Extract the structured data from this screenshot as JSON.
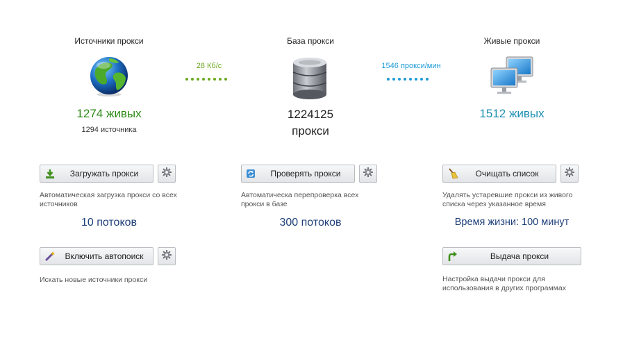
{
  "sources": {
    "title": "Источники прокси",
    "live_count": "1274 живых",
    "source_count": "1294 источника",
    "load_button": "Загружать прокси",
    "load_desc": "Автоматическая загрузка прокси со всех источников",
    "threads": "10 потоков",
    "autosearch_button": "Включить автопоиск",
    "autosearch_desc": "Искать новые источники прокси"
  },
  "flow_left": {
    "label": "28 Кб/с",
    "color": "#6aa81e"
  },
  "database": {
    "title": "База прокси",
    "count_line1": "1224125",
    "count_line2": "прокси",
    "check_button": "Проверять прокси",
    "check_desc": "Автоматическа перепроверка всех прокси в базе",
    "threads": "300 потоков"
  },
  "flow_right": {
    "label": "1546 прокси/мин",
    "color": "#1b9ad6"
  },
  "live": {
    "title": "Живые прокси",
    "live_count": "1512 живых",
    "clear_button": "Очищать список",
    "clear_desc": "Удалять устаревшие прокси из живого списка через указанное время",
    "lifetime": "Время жизни: 100 минут",
    "output_button": "Выдача прокси",
    "output_desc": "Настройка выдачи прокси для использования в других программах"
  },
  "icons": {
    "sources": "globe-icon",
    "database": "database-icon",
    "live": "computers-icon",
    "load": "download-icon",
    "check": "refresh-icon",
    "clear": "broom-icon",
    "autosearch": "magic-wand-icon",
    "output": "arrow-turn-icon",
    "settings": "gear-icon"
  }
}
